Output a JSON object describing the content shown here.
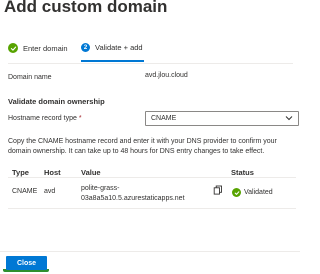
{
  "panel": {
    "title": "Add custom domain"
  },
  "steps": [
    {
      "label": "Enter domain",
      "state": "completed",
      "icon": "check-circle-icon"
    },
    {
      "label": "Validate + add",
      "number": "2",
      "state": "active"
    }
  ],
  "domain": {
    "label": "Domain name",
    "value": "avd.jlou.cloud"
  },
  "validation": {
    "heading": "Validate domain ownership",
    "record_type_label": "Hostname record type",
    "required_marker": "*",
    "record_type_value": "CNAME",
    "description": "Copy the CNAME hostname record and enter it with your DNS provider to confirm your domain ownership. It can take up to 48 hours for DNS entry changes to take effect."
  },
  "table": {
    "columns": [
      "Type",
      "Host",
      "Value",
      "Status"
    ],
    "row": {
      "type": "CNAME",
      "host": "avd",
      "value_line1": "polite-grass-",
      "value_line2": "03a8a5a10.5.azurestaticapps.net",
      "status": "Validated"
    }
  },
  "footer": {
    "close_label": "Close"
  },
  "colors": {
    "accent": "#0078d4",
    "success": "#57a300",
    "required": "#a4262c"
  }
}
